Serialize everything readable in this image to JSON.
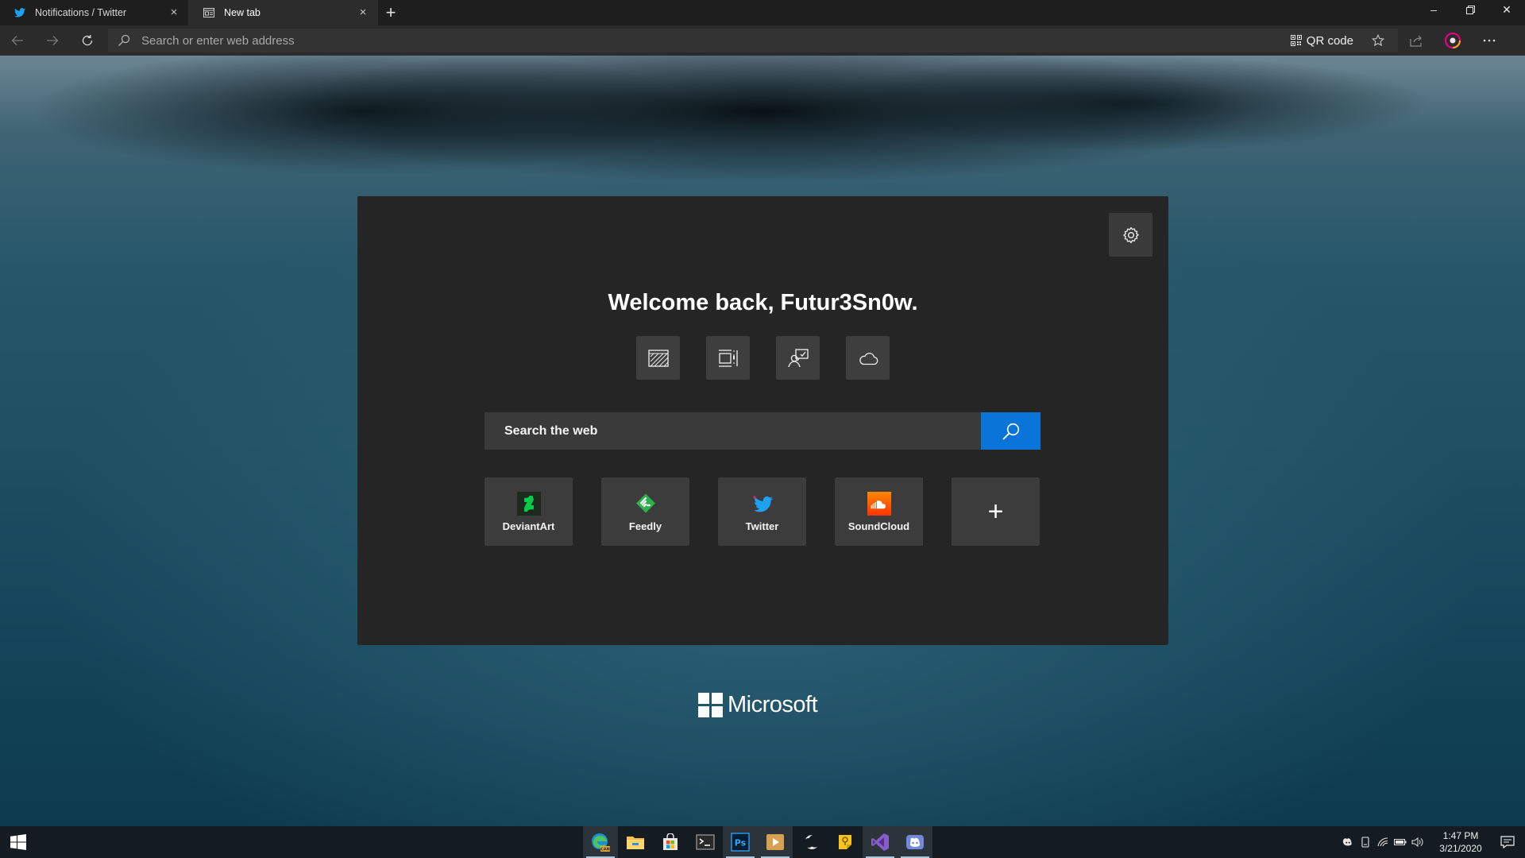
{
  "tabs": [
    {
      "title": "Notifications / Twitter",
      "icon": "twitter-icon",
      "active": false,
      "close_label": "×"
    },
    {
      "title": "New tab",
      "icon": "newtab-icon",
      "active": true,
      "close_label": "×"
    }
  ],
  "new_tab_label": "+",
  "window_controls": {
    "minimize": "–",
    "restore": "❐",
    "close": "✕"
  },
  "address_bar": {
    "placeholder": "Search or enter web address",
    "qr_label": "QR code"
  },
  "card": {
    "welcome": "Welcome back, Futur3Sn0w.",
    "quick_icons": [
      "wallpaper-icon",
      "news-layout-icon",
      "focus-icon",
      "weather-cloud-icon"
    ],
    "search_placeholder": "Search the web",
    "tiles": [
      {
        "label": "DeviantArt",
        "icon": "deviantart-icon",
        "color": "#05cc47"
      },
      {
        "label": "Feedly",
        "icon": "feedly-icon",
        "color": "#2bb24c"
      },
      {
        "label": "Twitter",
        "icon": "twitter-icon",
        "color": "#1da1f2"
      },
      {
        "label": "SoundCloud",
        "icon": "soundcloud-icon",
        "color": "#ff5500"
      }
    ],
    "add_tile_label": "+"
  },
  "brand": {
    "text": "Microsoft"
  },
  "taskbar": {
    "apps": [
      "edge-can-icon",
      "file-explorer-icon",
      "store-icon",
      "terminal-icon",
      "photoshop-icon",
      "media-player-icon",
      "moon-app-icon",
      "sticky-notes-icon",
      "visual-studio-icon",
      "discord-icon"
    ],
    "photoshop_label": "Ps",
    "clock_time": "1:47 PM",
    "clock_date": "3/21/2020"
  },
  "colors": {
    "accent": "#0a74d8",
    "card_bg": "#252525",
    "toolbar_bg": "#2b2b2b",
    "tab_bg": "#1e1e1e"
  }
}
